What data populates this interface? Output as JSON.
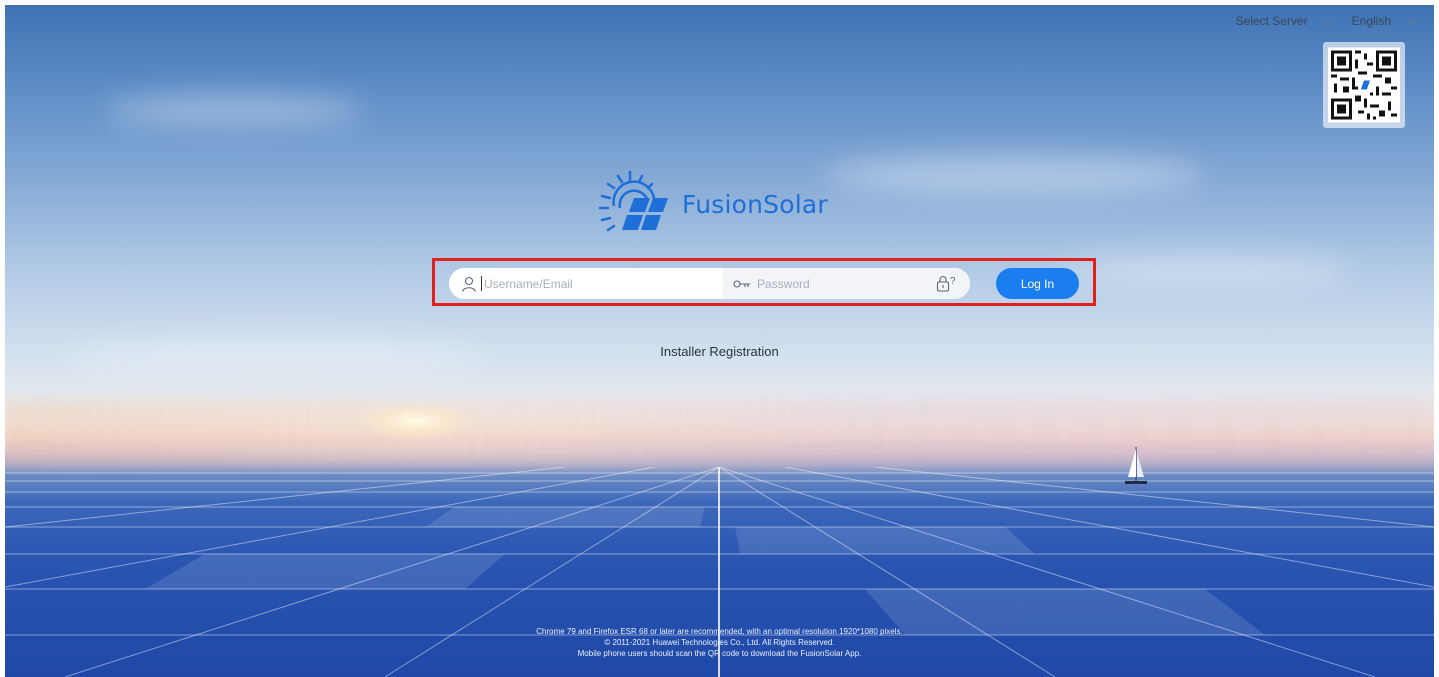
{
  "header": {
    "server_select": "Select Server",
    "language_select": "English"
  },
  "qr": {
    "icon": "qr-code-icon"
  },
  "brand": {
    "name": "FusionSolar",
    "logo_icon": "sun-solar-panel-icon",
    "color": "#1e6fd8"
  },
  "login": {
    "username_placeholder": "Username/Email",
    "password_placeholder": "Password",
    "user_icon": "user-icon",
    "password_icon": "key-icon",
    "forgot_icon": "lock-question-icon",
    "login_label": "Log In",
    "accent": "#1b7ef0"
  },
  "register": {
    "label": "Installer Registration"
  },
  "footer": {
    "line1": "Chrome 79 and Firefox ESR 68 or later are recommended, with an optimal resolution 1920*1080 pixels.",
    "line2": "© 2011-2021 Huawei Technologies Co., Ltd. All Rights Reserved.",
    "line3": "Mobile phone users should scan the QR code to download the FusionSolar App."
  },
  "highlight_color": "#e0201b"
}
